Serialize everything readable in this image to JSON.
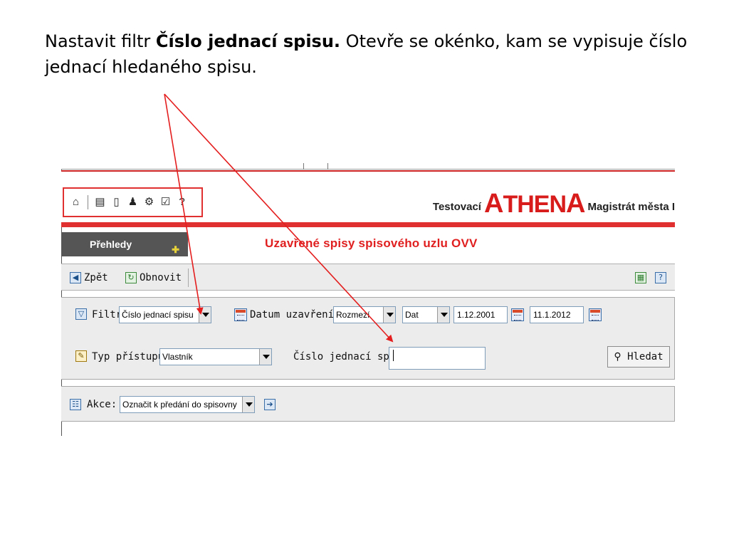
{
  "caption": {
    "part1": "Nastavit filtr ",
    "bold": "Číslo jednací spisu.",
    "part2": " Otevře se okénko, kam se vypisuje číslo jednací  hledaného spisu."
  },
  "header": {
    "help_label": "?",
    "brand_prefix": "Testovací",
    "brand_name_a": "A",
    "brand_name_mid": "THEN",
    "brand_name_end": "A",
    "brand_suffix": "Magistrát města I"
  },
  "nav": {
    "tab_label": "Přehledy",
    "page_title": "Uzavřené spisy spisového uzlu OVV"
  },
  "toolbar": {
    "back_label": "Zpět",
    "refresh_label": "Obnovit",
    "help_label": "?"
  },
  "filters": {
    "filter_label": "Filtr:",
    "filter_value": "Číslo jednací spisu",
    "date_label": "Datum uzavření:",
    "range_value": "Rozmezí",
    "date_type_value": "Dat",
    "date_from": "1.12.2001",
    "date_to": "11.1.2012",
    "access_label": "Typ přístupu:",
    "access_value": "Vlastník",
    "number_label": "Číslo jednací spisu:",
    "number_value": "",
    "search_label": "Hledat"
  },
  "actions": {
    "label": "Akce:",
    "value": "Označit k předání do spisovny"
  },
  "colors": {
    "accent_red": "#e03030",
    "title_red": "#e02020",
    "panel_gray": "#ececec",
    "nav_gray": "#555555"
  }
}
